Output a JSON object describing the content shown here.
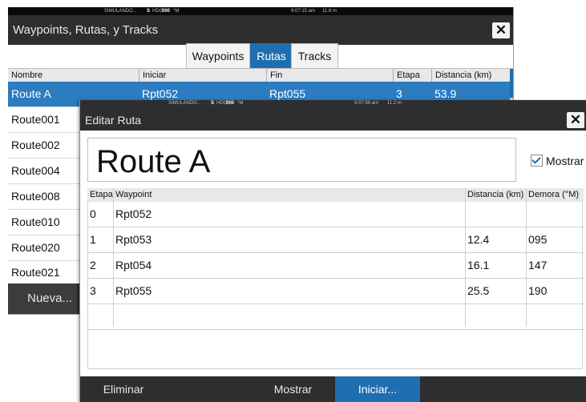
{
  "back_window": {
    "status": {
      "mode": "SIMULANDO...",
      "hdg_prefix": "S",
      "hdg_label": "HDG",
      "hdg_value": "000",
      "hdg_unit": "°M",
      "time": "9:07:15 am",
      "distance": "11.6 m"
    },
    "title": "Waypoints, Rutas, y Tracks",
    "close_symbol": "✕",
    "tabs": [
      {
        "label": "Waypoints"
      },
      {
        "label": "Rutas",
        "active": true
      },
      {
        "label": "Tracks"
      }
    ],
    "columns": [
      "Nombre",
      "Iniciar",
      "Fin",
      "Etapa",
      "Distancia (km)"
    ],
    "rows": [
      {
        "nombre": "Route A",
        "iniciar": "Rpt052",
        "fin": "Rpt055",
        "etapa": "3",
        "distancia": "53.9",
        "selected": true
      },
      {
        "nombre": "Route001"
      },
      {
        "nombre": "Route002"
      },
      {
        "nombre": "Route004"
      },
      {
        "nombre": "Route008"
      },
      {
        "nombre": "Route010"
      },
      {
        "nombre": "Route020"
      },
      {
        "nombre": "Route021"
      }
    ],
    "new_button": "Nueva..."
  },
  "dialog": {
    "status": {
      "mode": "SIMULANDO...",
      "hdg_prefix": "S",
      "hdg_label": "HDG",
      "hdg_value": "000",
      "hdg_unit": "°M",
      "time": "9:07:39 am",
      "distance": "11.2 m"
    },
    "title": "Editar Ruta",
    "close_symbol": "✕",
    "route_name": "Route A",
    "show_checkbox": {
      "label": "Mostrar",
      "checked": true
    },
    "columns": [
      "Etapa",
      "Waypoint",
      "Distancia (km)",
      "Demora (°M)"
    ],
    "legs": [
      {
        "etapa": "0",
        "waypoint": "Rpt052",
        "distancia": "",
        "demora": ""
      },
      {
        "etapa": "1",
        "waypoint": "Rpt053",
        "distancia": "12.4",
        "demora": "095"
      },
      {
        "etapa": "2",
        "waypoint": "Rpt054",
        "distancia": "16.1",
        "demora": "147"
      },
      {
        "etapa": "3",
        "waypoint": "Rpt055",
        "distancia": "25.5",
        "demora": "190"
      },
      {
        "etapa": "",
        "waypoint": "",
        "distancia": "",
        "demora": ""
      }
    ],
    "buttons": {
      "delete": "Eliminar",
      "show": "Mostrar",
      "start": "Iniciar..."
    }
  },
  "colors": {
    "accent": "#1f6fb0",
    "titlebar": "#2e2e2e",
    "status_bar": "#0a0a0a",
    "selected_row": "#2b7cc0"
  },
  "icons": {
    "close": "close-icon",
    "checkbox": "checkmark-icon"
  }
}
